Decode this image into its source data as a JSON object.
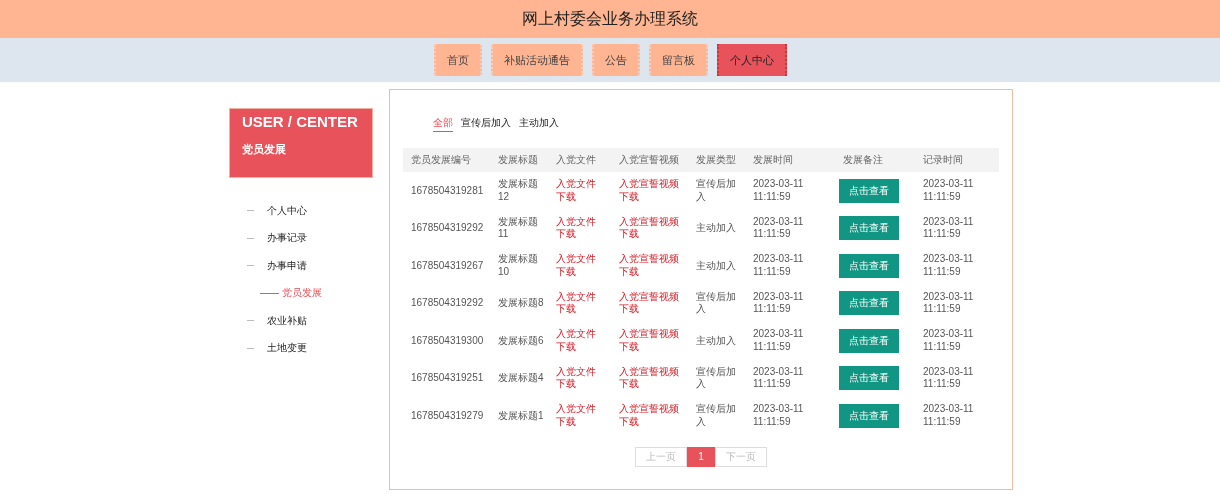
{
  "header": {
    "title": "网上村委会业务办理系统"
  },
  "nav": [
    {
      "label": "首页",
      "selected": false
    },
    {
      "label": "补贴活动通告",
      "selected": false
    },
    {
      "label": "公告",
      "selected": false
    },
    {
      "label": "留言板",
      "selected": false
    },
    {
      "label": "个人中心",
      "selected": true
    }
  ],
  "sidebar": {
    "heading": "USER / CENTER",
    "subheading": "党员发展",
    "items": [
      {
        "label": "个人中心",
        "selected": false
      },
      {
        "label": "办事记录",
        "selected": false
      },
      {
        "label": "办事申请",
        "selected": false,
        "children": [
          {
            "label": "党员发展",
            "selected": true
          }
        ]
      },
      {
        "label": "农业补贴",
        "selected": false
      },
      {
        "label": "土地变更",
        "selected": false
      }
    ]
  },
  "filters": [
    {
      "label": "全部",
      "selected": true
    },
    {
      "label": "宣传后加入",
      "selected": false
    },
    {
      "label": "主动加入",
      "selected": false
    }
  ],
  "table": {
    "columns": [
      "党员发展编号",
      "发展标题",
      "入党文件",
      "入党宣誓视频",
      "发展类型",
      "发展时间",
      "发展备注",
      "记录时间"
    ],
    "rows": [
      {
        "id": "1678504319281",
        "title": "发展标题12",
        "file": "入党文件下载",
        "video": "入党宣誓视频下载",
        "type": "宣传后加入",
        "time": "2023-03-11 11:11:59",
        "note": "点击查看",
        "recorded": "2023-03-11 11:11:59"
      },
      {
        "id": "1678504319292",
        "title": "发展标题11",
        "file": "入党文件下载",
        "video": "入党宣誓视频下载",
        "type": "主动加入",
        "time": "2023-03-11 11:11:59",
        "note": "点击查看",
        "recorded": "2023-03-11 11:11:59"
      },
      {
        "id": "1678504319267",
        "title": "发展标题10",
        "file": "入党文件下载",
        "video": "入党宣誓视频下载",
        "type": "主动加入",
        "time": "2023-03-11 11:11:59",
        "note": "点击查看",
        "recorded": "2023-03-11 11:11:59"
      },
      {
        "id": "1678504319292",
        "title": "发展标题8",
        "file": "入党文件下载",
        "video": "入党宣誓视频下载",
        "type": "宣传后加入",
        "time": "2023-03-11 11:11:59",
        "note": "点击查看",
        "recorded": "2023-03-11 11:11:59"
      },
      {
        "id": "1678504319300",
        "title": "发展标题6",
        "file": "入党文件下载",
        "video": "入党宣誓视频下载",
        "type": "主动加入",
        "time": "2023-03-11 11:11:59",
        "note": "点击查看",
        "recorded": "2023-03-11 11:11:59"
      },
      {
        "id": "1678504319251",
        "title": "发展标题4",
        "file": "入党文件下载",
        "video": "入党宣誓视频下载",
        "type": "宣传后加入",
        "time": "2023-03-11 11:11:59",
        "note": "点击查看",
        "recorded": "2023-03-11 11:11:59"
      },
      {
        "id": "1678504319279",
        "title": "发展标题1",
        "file": "入党文件下载",
        "video": "入党宣誓视频下载",
        "type": "宣传后加入",
        "time": "2023-03-11 11:11:59",
        "note": "点击查看",
        "recorded": "2023-03-11 11:11:59"
      }
    ]
  },
  "pagination": {
    "prev": "上一页",
    "pages": [
      {
        "label": "1",
        "selected": true
      }
    ],
    "next": "下一页"
  }
}
